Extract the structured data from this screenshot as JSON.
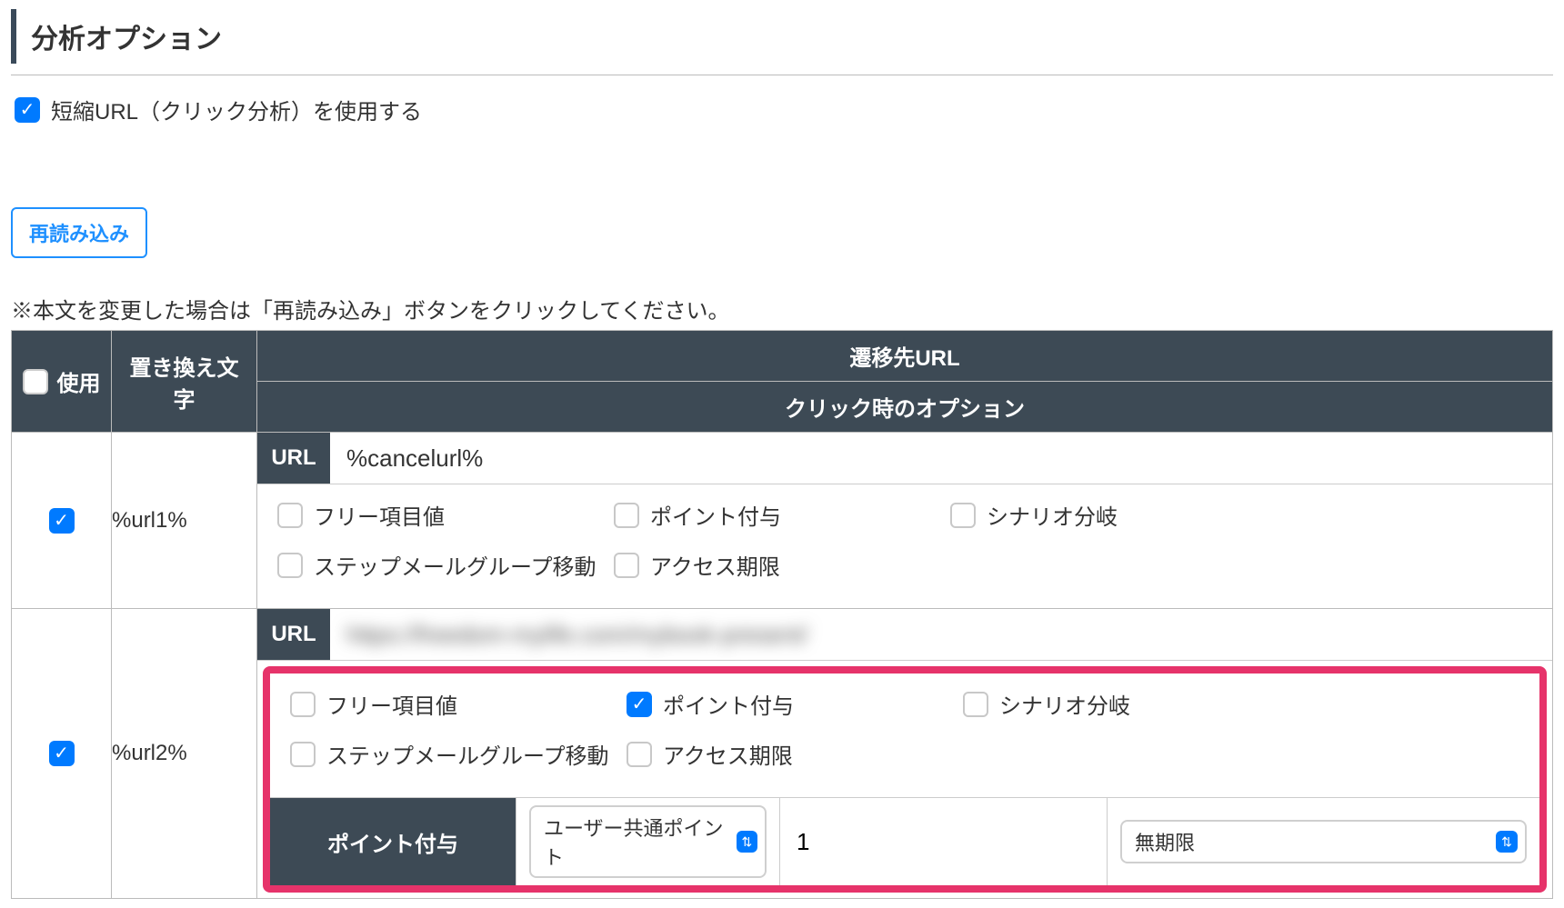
{
  "section_title": "分析オプション",
  "top_checkbox": {
    "checked": true,
    "label": "短縮URL（クリック分析）を使用する"
  },
  "reload_button": "再読み込み",
  "note": "※本文を変更した場合は「再読み込み」ボタンをクリックしてください。",
  "table": {
    "headers": {
      "use": "使用",
      "replace": "置き換え文字",
      "dest_url": "遷移先URL",
      "click_options": "クリック時のオプション"
    },
    "url_label": "URL",
    "option_labels": {
      "free_item": "フリー項目値",
      "point_grant": "ポイント付与",
      "scenario_branch": "シナリオ分岐",
      "step_mail_move": "ステップメールグループ移動",
      "access_limit": "アクセス期限"
    },
    "rows": [
      {
        "use_checked": true,
        "replace_text": "%url1%",
        "url_value": "%cancelurl%",
        "url_blurred": false,
        "options": {
          "free_item": false,
          "point_grant": false,
          "scenario_branch": false,
          "step_mail_move": false,
          "access_limit": false
        },
        "highlighted": false
      },
      {
        "use_checked": true,
        "replace_text": "%url2%",
        "url_value": "https://freedom-mylife.com/mybook-present/",
        "url_blurred": true,
        "options": {
          "free_item": false,
          "point_grant": true,
          "scenario_branch": false,
          "step_mail_move": false,
          "access_limit": false
        },
        "highlighted": true,
        "point_grant_detail": {
          "label": "ポイント付与",
          "point_type": "ユーザー共通ポイント",
          "value": "1",
          "expiry": "無期限"
        }
      }
    ]
  }
}
